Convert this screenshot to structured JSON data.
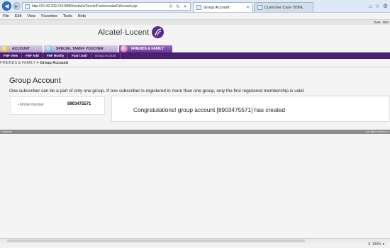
{
  "browser": {
    "url": "http://10.42.209.215:8080/webvfs/ServletFacto/createGAccount.jsp",
    "tabs": [
      {
        "label": "Group Account"
      },
      {
        "label": "Customer Care- BSNL"
      }
    ],
    "menu": [
      "File",
      "Edit",
      "View",
      "Favorites",
      "Tools",
      "Help"
    ],
    "zoom": "100%"
  },
  "header": {
    "brand": "Alcatel·Lucent",
    "date_label": "Date:  18/0"
  },
  "main_tabs": [
    {
      "label": "ACCOUNT"
    },
    {
      "label": "SPECIAL TARIFF VOUCHER"
    },
    {
      "label": "FRIENDS & FAMILY"
    }
  ],
  "sub_nav": [
    "FNF View",
    "FNF Add",
    "FNF Modify",
    "Fyart Jodi",
    "Group Account"
  ],
  "breadcrumb": {
    "parent": "FRIENDS & FAMILY",
    "separator": " > ",
    "current": "Group Account"
  },
  "page": {
    "title": "Group Account",
    "info": "One subscriber can be a part of only one group. If one subscriber is registered in more than one group, only the first registered membership is valid",
    "mobile_label": "• Mobile Number",
    "mobile_value": "8903475571",
    "message": "Congratulations! group account [8903475571] has created"
  },
  "footer": {
    "left": "Contents",
    "right": "All rights reserved"
  }
}
